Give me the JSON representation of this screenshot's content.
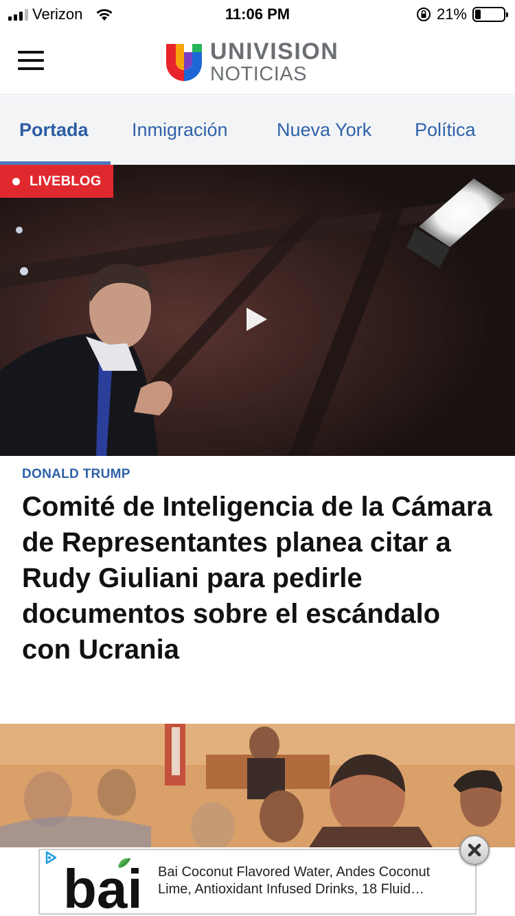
{
  "status_bar": {
    "carrier": "Verizon",
    "time": "11:06 PM",
    "battery_text": "21%",
    "battery_level": 0.21
  },
  "header": {
    "logo_line1": "UNIVISION",
    "logo_line2": "NOTICIAS"
  },
  "nav": {
    "tabs": [
      {
        "label": "Portada",
        "active": true
      },
      {
        "label": "Inmigración",
        "active": false
      },
      {
        "label": "Nueva York",
        "active": false
      },
      {
        "label": "Política",
        "active": false
      }
    ]
  },
  "hero": {
    "badge": "LIVEBLOG"
  },
  "article": {
    "category": "DONALD TRUMP",
    "headline": "Comité de Inteligencia de la Cámara de Representantes planea citar a Rudy Giuliani para pedirle documentos sobre el escándalo con Ucrania"
  },
  "ad": {
    "brand": "bai",
    "text_line1": "Bai Coconut Flavored Water, Andes Coconut",
    "text_line2": "Lime, Antioxidant Infused Drinks, 18 Fluid…"
  },
  "colors": {
    "accent_blue": "#2f62a8",
    "live_red": "#e0292f"
  }
}
